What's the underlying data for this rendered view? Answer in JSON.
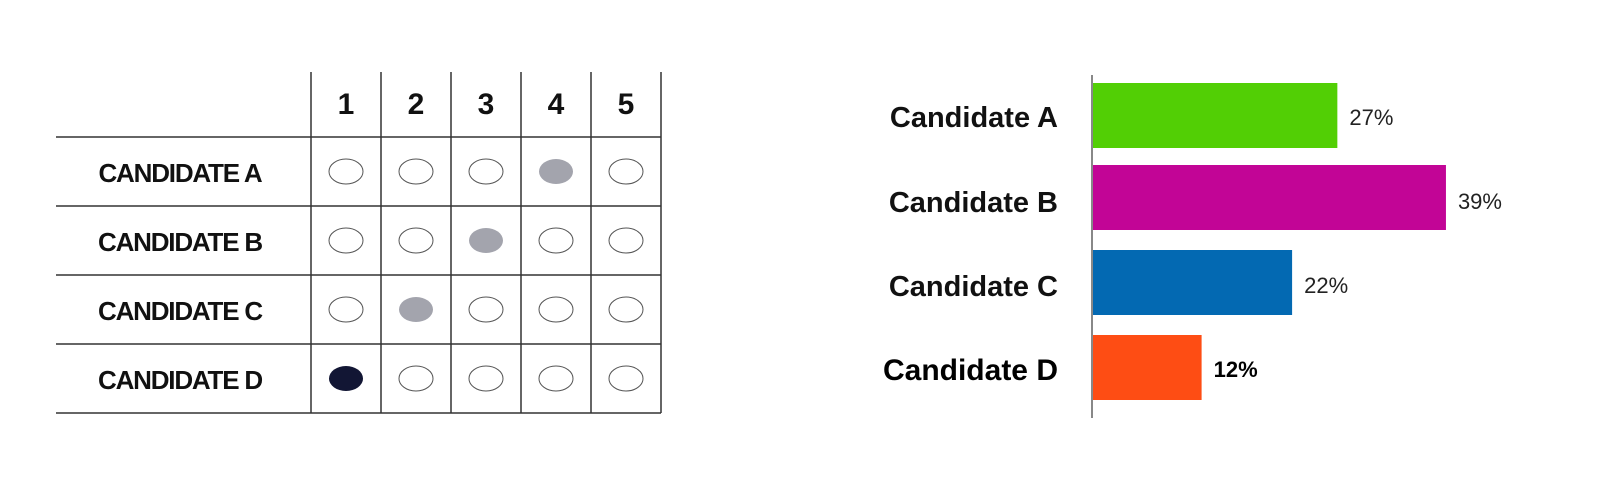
{
  "ballot": {
    "columns": [
      "1",
      "2",
      "3",
      "4",
      "5"
    ],
    "rows": [
      {
        "label": "CANDIDATE A",
        "marked_rank": 4,
        "mark": "gray"
      },
      {
        "label": "CANDIDATE B",
        "marked_rank": 3,
        "mark": "gray"
      },
      {
        "label": "CANDIDATE C",
        "marked_rank": 2,
        "mark": "gray"
      },
      {
        "label": "CANDIDATE D",
        "marked_rank": 1,
        "mark": "dark"
      }
    ],
    "colors": {
      "gray": "#a3a4ad",
      "dark": "#121634",
      "line": "#333333",
      "empty_stroke": "#555555"
    }
  },
  "chart_data": {
    "type": "bar",
    "orientation": "horizontal",
    "title": "",
    "xlabel": "",
    "ylabel": "",
    "categories": [
      "Candidate A",
      "Candidate B",
      "Candidate C",
      "Candidate D"
    ],
    "values": [
      27,
      39,
      22,
      12
    ],
    "value_labels": [
      "27%",
      "39%",
      "22%",
      "12%"
    ],
    "unit": "%",
    "xlim": [
      0,
      40
    ],
    "grid": false,
    "legend": "none",
    "colors": [
      "#52cf05",
      "#c20596",
      "#0369b2",
      "#fe4d14"
    ],
    "emphasized_category": "Candidate D",
    "axis_color": "#888888"
  }
}
